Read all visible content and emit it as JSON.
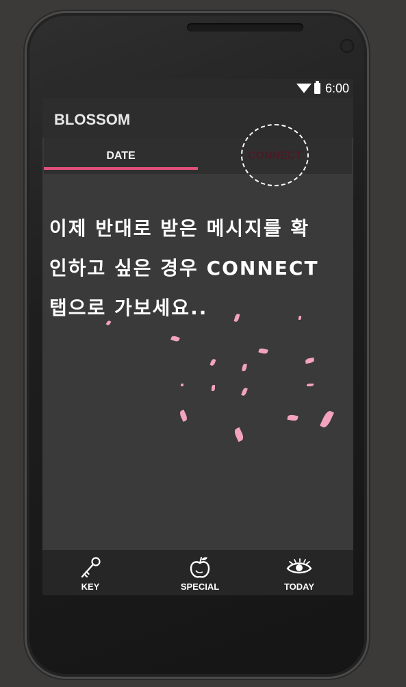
{
  "status_bar": {
    "time": "6:00",
    "wifi_icon": "wifi-icon",
    "battery_icon": "battery-icon"
  },
  "app": {
    "title": "BLOSSOM"
  },
  "tabs": [
    {
      "label": "DATE",
      "selected": true
    },
    {
      "label": "CONNECT",
      "selected": false
    }
  ],
  "message": {
    "line1": "이제 반대로 받은 메시지를 확",
    "line2": "인하고 싶은 경우 CONNECT",
    "line3": "탭으로 가보세요.."
  },
  "bottom_nav": [
    {
      "label": "KEY",
      "icon": "key-icon"
    },
    {
      "label": "SPECIAL",
      "icon": "apple-icon"
    },
    {
      "label": "TODAY",
      "icon": "eye-icon"
    }
  ],
  "colors": {
    "accent": "#e2507a",
    "petal": "#f3a3bd",
    "background": "#3a3a3a",
    "connect_tab_text": "#4a1b26"
  }
}
